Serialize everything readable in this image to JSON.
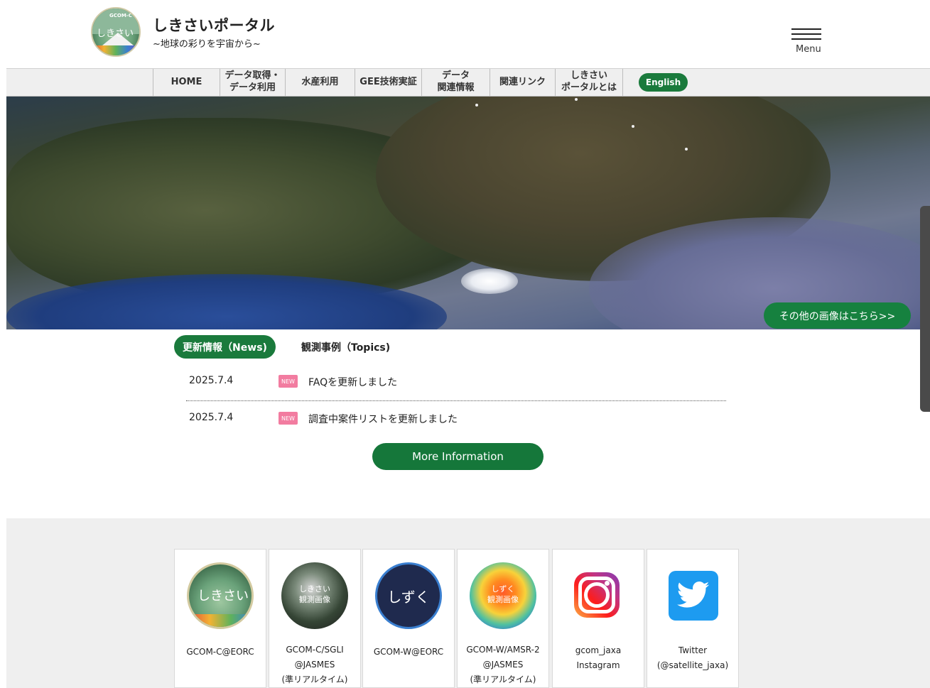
{
  "header": {
    "title": "しきさいポータル",
    "subtitle": "~地球の彩りを宇宙から~",
    "logo_badge": "GCOM-C",
    "logo_text": "しきさい",
    "menu_label": "Menu"
  },
  "nav": {
    "items": [
      {
        "label": "HOME"
      },
      {
        "label": "データ取得・\nデータ利用"
      },
      {
        "label": "水産利用"
      },
      {
        "label": "GEE技術実証"
      },
      {
        "label": "データ\n関連情報"
      },
      {
        "label": "関連リンク"
      },
      {
        "label": "しきさい\nポータルとは"
      }
    ],
    "english_label": "English"
  },
  "hero": {
    "more_images_label": "その他の画像はこちら>>"
  },
  "news": {
    "tabs": [
      {
        "label": "更新情報（News)"
      },
      {
        "label": "観測事例（Topics)"
      }
    ],
    "items": [
      {
        "date": "2025.7.4",
        "badge": "NEW",
        "text": "FAQを更新しました"
      },
      {
        "date": "2025.7.4",
        "badge": "NEW",
        "text": "調査中案件リストを更新しました"
      }
    ],
    "more_label": "More Information"
  },
  "links": [
    {
      "label": "GCOM-C@EORC",
      "icon": "shikisai-logo-icon",
      "icon_text": "しきさい"
    },
    {
      "label": "GCOM-C/SGLI\n@JASMES\n(準リアルタイム)",
      "icon": "sgli-globe-icon",
      "icon_text": "しきさい\n観測画像"
    },
    {
      "label": "GCOM-W@EORC",
      "icon": "shizuku-logo-icon",
      "icon_text": "しずく"
    },
    {
      "label": "GCOM-W/AMSR-2\n@JASMES\n(準リアルタイム)",
      "icon": "amsr-globe-icon",
      "icon_text": "しずく\n観測画像"
    },
    {
      "label": "gcom_jaxa\nInstagram",
      "icon": "instagram-icon"
    },
    {
      "label": "Twitter\n(@satellite_jaxa)",
      "icon": "twitter-icon"
    }
  ],
  "colors": {
    "brand_green": "#1a7a3c",
    "new_badge": "#f27ca0",
    "nav_bg": "#efefef"
  }
}
